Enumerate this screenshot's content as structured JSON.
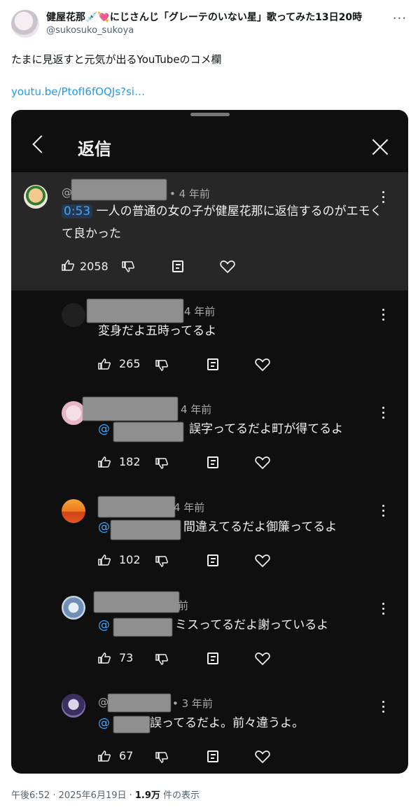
{
  "tweet": {
    "author_name": "健屋花那💉💘にじさんじ「グレーテのいない星」歌ってみた13日20時",
    "handle": "@sukosuko_sukoya",
    "text": "たまに見返すと元気が出るYouTubeのコメ欄",
    "link": "youtu.be/PtofI6fOQJs?si…",
    "footer_time": "午後6:52 · 2025年6月19日 · ",
    "views": "1.9万",
    "views_suffix": " 件の表示"
  },
  "card": {
    "title": "返信"
  },
  "comments": [
    {
      "prefix": "@",
      "age": "• 4 年前",
      "timestamp": "0:53",
      "text": "一人の普通の女の子が健屋花那に返信するのがエモくて良かった",
      "likes": "2058"
    },
    {
      "prefix": "",
      "age": "4 年前",
      "mention": "",
      "text": "変身だよ五時ってるよ",
      "likes": "265"
    },
    {
      "prefix": "",
      "age": "4 年前",
      "mention": "@",
      "text": "誤字ってるだよ町が得てるよ",
      "likes": "182"
    },
    {
      "prefix": "",
      "age": "4 年前",
      "mention": "@",
      "text": "間違えてるだよ御簾ってるよ",
      "likes": "102"
    },
    {
      "prefix": "",
      "age": "前",
      "mention": "@",
      "text": "ミスってるだよ謝っているよ",
      "likes": "73"
    },
    {
      "prefix": "@",
      "age": "• 3 年前",
      "mention": "@",
      "text": "誤ってるだよ。前々違うよ。",
      "likes": "67"
    }
  ]
}
